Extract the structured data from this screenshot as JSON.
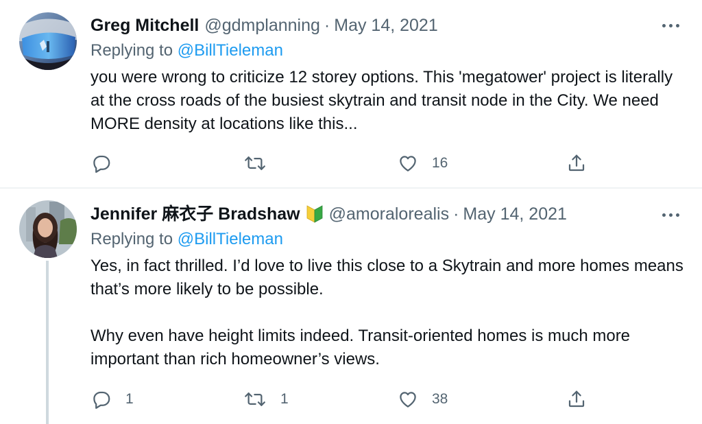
{
  "tweets": [
    {
      "author_name": "Greg Mitchell",
      "handle": "@gdmplanning",
      "date": "May 14, 2021",
      "replying_prefix": "Replying to ",
      "replying_to": "@BillTieleman",
      "text": [
        "you were wrong to criticize 12 storey options. This 'megatower' project is literally at the cross roads of the busiest skytrain and transit node in the City. We need MORE density at locations like this..."
      ],
      "replies": "",
      "retweets": "",
      "likes": "16"
    },
    {
      "author_name": "Jennifer 麻衣子 Bradshaw",
      "handle": "@amoralorealis",
      "date": "May 14, 2021",
      "replying_prefix": "Replying to ",
      "replying_to": "@BillTieleman",
      "text": [
        "Yes, in fact thrilled. I’d love to live this close to a Skytrain and more homes means that’s more likely to be possible.",
        "Why even have height limits indeed. Transit-oriented homes is much more important than rich homeowner’s views."
      ],
      "replies": "1",
      "retweets": "1",
      "likes": "38"
    }
  ],
  "separator_dot": "·",
  "icons": {
    "reply": "reply-bubble-icon",
    "retweet": "retweet-arrows-icon",
    "like": "heart-icon",
    "share": "share-upload-icon",
    "more": "more-dots-icon",
    "badge": "japanese-beginner-badge-icon"
  },
  "colors": {
    "text": "#0f1419",
    "secondary": "#536471",
    "link": "#1d9bf0",
    "divider": "#eff3f4",
    "thread_line": "#cfd9de"
  }
}
